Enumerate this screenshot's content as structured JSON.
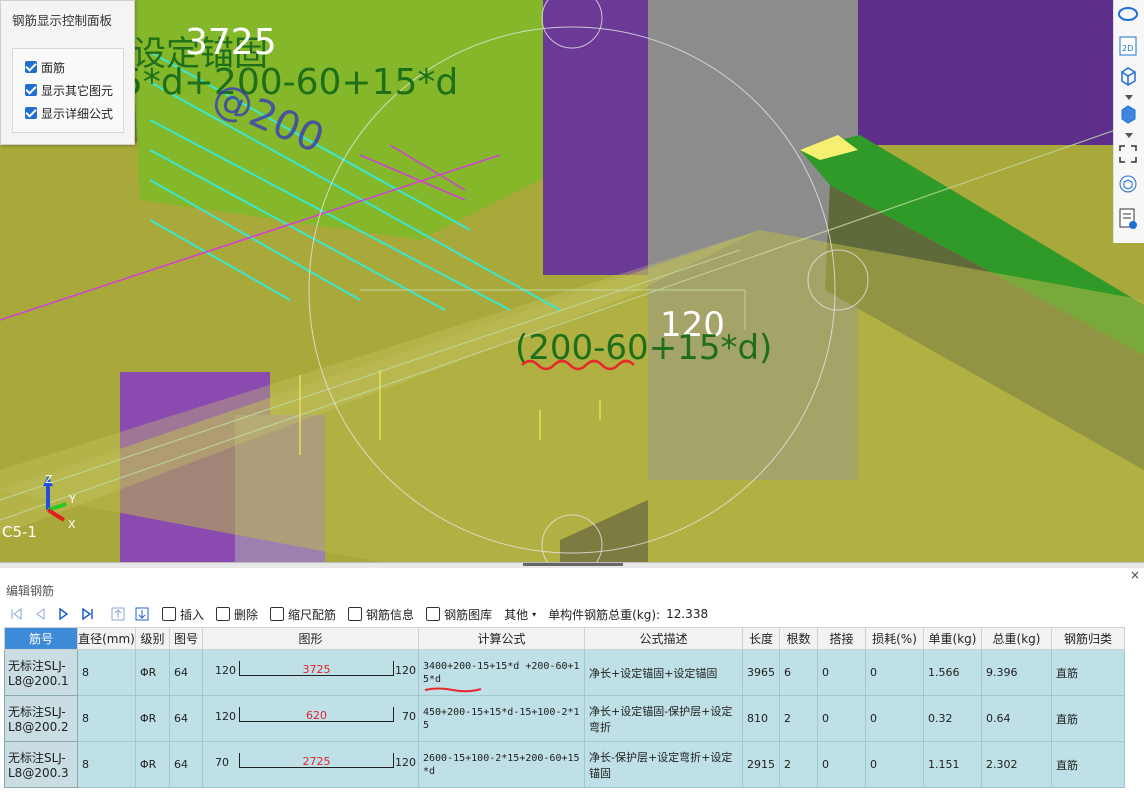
{
  "control_panel": {
    "title": "钢筋显示控制面板",
    "options": [
      {
        "label": "面筋",
        "checked": true
      },
      {
        "label": "显示其它图元",
        "checked": true
      },
      {
        "label": "显示详细公式",
        "checked": true
      }
    ]
  },
  "viewport": {
    "annotation_top_value": "3725",
    "annotation_top_label": "设定锚固",
    "annotation_top_formula": "5*d+200-60+15*d",
    "annotation_spacing": "@200",
    "annotation_mid_value": "120",
    "annotation_mid_formula": "(200-60+15*d)",
    "component_label": "C5-1",
    "axis_labels": {
      "z": "Z",
      "y": "Y",
      "x": "X"
    },
    "side_tools": [
      "ellipse-icon",
      "2d-view-icon",
      "cube-outline-icon",
      "cube-solid-icon",
      "fullscreen-icon",
      "component-cube-icon",
      "report-icon"
    ]
  },
  "editor": {
    "title": "编辑钢筋",
    "close": "×",
    "toolbar": {
      "insert": "插入",
      "delete": "删除",
      "scale_rebar": "缩尺配筋",
      "rebar_info": "钢筋信息",
      "rebar_library": "钢筋图库",
      "other": "其他",
      "total_weight_label": "单构件钢筋总重(kg):",
      "total_weight_value": "12.338"
    },
    "columns": [
      "筋号",
      "直径(mm)",
      "级别",
      "图号",
      "图形",
      "计算公式",
      "公式描述",
      "长度",
      "根数",
      "搭接",
      "损耗(%)",
      "单重(kg)",
      "总重(kg)",
      "钢筋归类"
    ],
    "rows": [
      {
        "name": "无标注SLJ-L8@200.1",
        "diameter": "8",
        "grade": "ΦR",
        "fig": "64",
        "shape_left": "120",
        "shape_mid": "3725",
        "shape_right": "120",
        "formula": "3400+200-15+15*d +200-60+15*d",
        "desc": "净长+设定锚固+设定锚固",
        "length": "3965",
        "count": "6",
        "lap": "0",
        "loss": "0",
        "unit_w": "1.566",
        "total_w": "9.396",
        "category": "直筋"
      },
      {
        "name": "无标注SLJ-L8@200.2",
        "diameter": "8",
        "grade": "ΦR",
        "fig": "64",
        "shape_left": "120",
        "shape_mid": "620",
        "shape_right": "70",
        "formula": "450+200-15+15*d-15+100-2*15",
        "desc": "净长+设定锚固-保护层+设定弯折",
        "length": "810",
        "count": "2",
        "lap": "0",
        "loss": "0",
        "unit_w": "0.32",
        "total_w": "0.64",
        "category": "直筋"
      },
      {
        "name": "无标注SLJ-L8@200.3",
        "diameter": "8",
        "grade": "ΦR",
        "fig": "64",
        "shape_left": "70",
        "shape_mid": "2725",
        "shape_right": "120",
        "formula": "2600-15+100-2*15+200-60+15*d",
        "desc": "净长-保护层+设定弯折+设定锚固",
        "length": "2915",
        "count": "2",
        "lap": "0",
        "loss": "0",
        "unit_w": "1.151",
        "total_w": "2.302",
        "category": "直筋"
      }
    ]
  }
}
